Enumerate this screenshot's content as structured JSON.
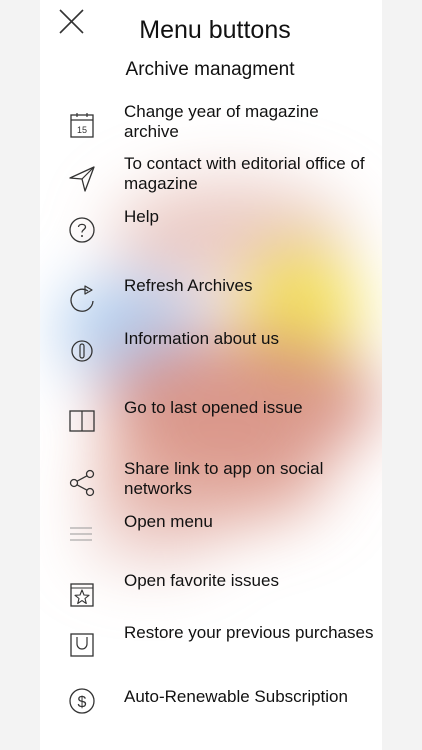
{
  "header": {
    "title": "Menu buttons",
    "subtitle": "Archive managment"
  },
  "menu": {
    "items": [
      {
        "label": "Change year of magazine archive",
        "icon": "calendar-icon",
        "icon_text": "15"
      },
      {
        "label": "To contact  with editorial office of magazine",
        "icon": "send-icon"
      },
      {
        "label": "Help",
        "icon": "help-icon"
      },
      {
        "label": "Refresh Archives",
        "icon": "refresh-icon"
      },
      {
        "label": "Information about us",
        "icon": "info-icon"
      },
      {
        "label": "Go to last opened issue",
        "icon": "book-icon"
      },
      {
        "label": "Share link to app on social networks",
        "icon": "share-icon"
      },
      {
        "label": "Open menu",
        "icon": "menu-icon"
      },
      {
        "label": "Open favorite issues",
        "icon": "star-icon"
      },
      {
        "label": "Restore your previous purchases",
        "icon": "bag-icon"
      },
      {
        "label": "Auto-Renewable Subscription",
        "icon": "dollar-icon"
      }
    ]
  },
  "colors": {
    "text": "#111111",
    "icon_stroke": "#333333",
    "blur_red": "#d28070",
    "blur_yellow": "#f2dd40",
    "blur_blue": "#9ec2ec"
  }
}
